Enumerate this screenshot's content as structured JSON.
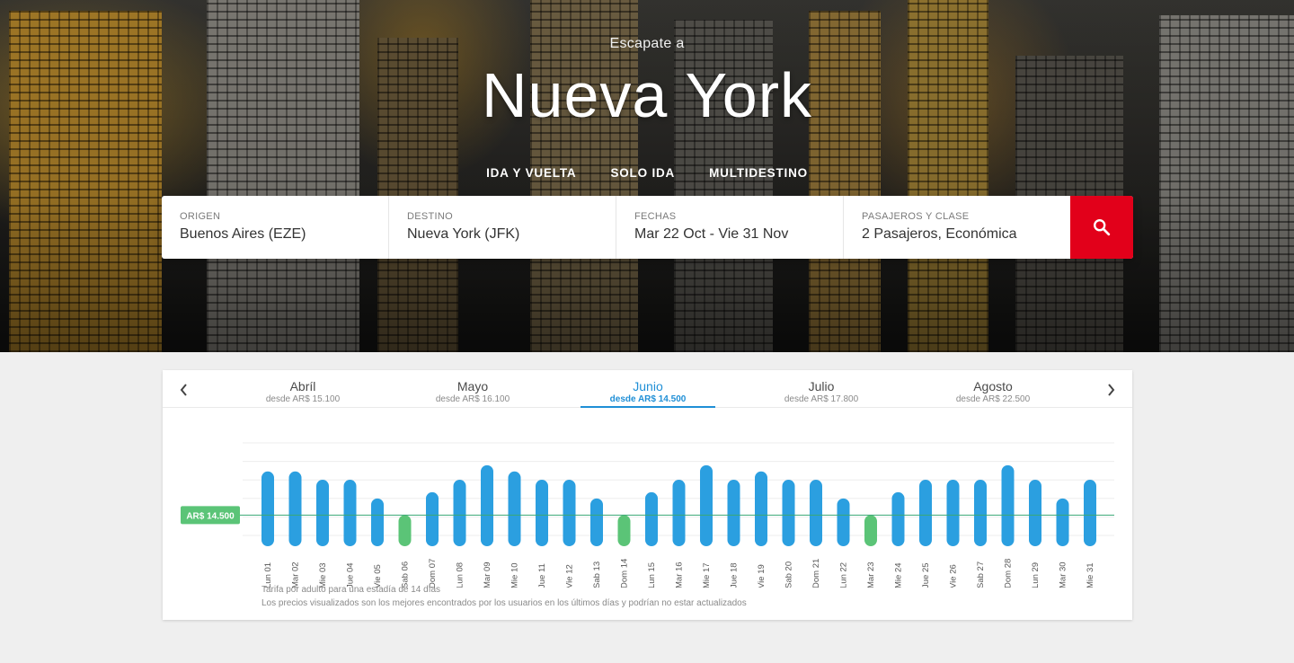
{
  "hero": {
    "eyebrow": "Escapate a",
    "title": "Nueva York"
  },
  "trip_tabs": [
    "IDA Y VUELTA",
    "SOLO IDA",
    "MULTIDESTINO"
  ],
  "search": {
    "origin_label": "ORIGEN",
    "origin_value": "Buenos Aires (EZE)",
    "destination_label": "DESTINO",
    "destination_value": "Nueva York (JFK)",
    "dates_label": "FECHAS",
    "dates_value": "Mar 22 Oct - Vie 31 Nov",
    "passengers_label": "PASAJEROS Y CLASE",
    "passengers_value": "2 Pasajeros, Económica",
    "button_icon": "search-icon",
    "button_color": "#e2001a"
  },
  "months": [
    {
      "name": "Abríl",
      "price": "desde AR$ 15.100",
      "active": false
    },
    {
      "name": "Mayo",
      "price": "desde AR$ 16.100",
      "active": false
    },
    {
      "name": "Junio",
      "price": "desde AR$ 14.500",
      "active": true
    },
    {
      "name": "Julio",
      "price": "desde AR$ 17.800",
      "active": false
    },
    {
      "name": "Agosto",
      "price": "desde AR$ 22.500",
      "active": false
    }
  ],
  "nav_icons": {
    "prev": "chevron-left-icon",
    "next": "chevron-right-icon"
  },
  "chart_data": {
    "type": "bar",
    "reference_label": "AR$ 14.500",
    "reference_value": 14500,
    "bar_color": "#2b9fe0",
    "lowest_color": "#5bc477",
    "reference_line_color": "#3aa874",
    "categories": [
      "Lun 01",
      "Mar 02",
      "Mie 03",
      "Jue 04",
      "Vie 05",
      "Sab 06",
      "Dom 07",
      "Lun 08",
      "Mar 09",
      "Mie 10",
      "Jue 11",
      "Vie 12",
      "Sab 13",
      "Dom 14",
      "Lun 15",
      "Mar 16",
      "Mie 17",
      "Jue 18",
      "Vie 19",
      "Sab 20",
      "Dom 21",
      "Lun 22",
      "Mar 23",
      "Mie 24",
      "Jue 25",
      "Vie 26",
      "Sab 27",
      "Dom 28",
      "Lun 29",
      "Mar 30",
      "Mie 31"
    ],
    "values": [
      16600,
      16600,
      16200,
      16200,
      15300,
      14500,
      15600,
      16200,
      16900,
      16600,
      16200,
      16200,
      15300,
      14500,
      15600,
      16200,
      16900,
      16200,
      16600,
      16200,
      16200,
      15300,
      14500,
      15600,
      16200,
      16200,
      16200,
      16900,
      16200,
      15300,
      16200
    ],
    "lowest": [
      false,
      false,
      false,
      false,
      false,
      true,
      false,
      false,
      false,
      false,
      false,
      false,
      false,
      true,
      false,
      false,
      false,
      false,
      false,
      false,
      false,
      false,
      true,
      false,
      false,
      false,
      false,
      false,
      false,
      false,
      false
    ],
    "ylim": [
      13000,
      17500
    ],
    "grid": true
  },
  "notes": {
    "line1": "Tarifa por adulto para una estadía de 14 días",
    "line2": "Los precios visualizados son los mejores encontrados por los usuarios en los últimos días y podrían no estar actualizados"
  }
}
